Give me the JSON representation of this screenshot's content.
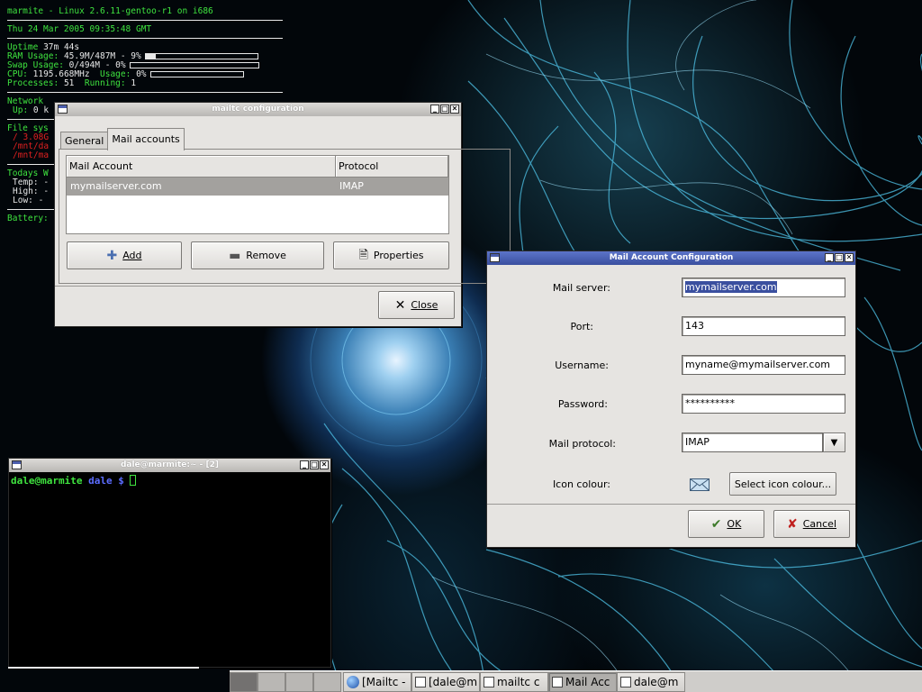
{
  "conky": {
    "header": "marmite - Linux 2.6.11-gentoo-r1 on i686",
    "datetime": "Thu 24 Mar 2005 09:35:48 GMT",
    "uptime_label": "Uptime",
    "uptime_value": "37m 44s",
    "ram_label": "RAM Usage:",
    "ram_value": "45.9M/487M - 9%",
    "ram_percent": 9,
    "swap_label": "Swap Usage:",
    "swap_value": "0/494M - 0%",
    "swap_percent": 0,
    "cpu_label": "CPU:",
    "cpu_value": "1195.668MHz",
    "cpu_usage_label": "Usage:",
    "cpu_usage_value": "0%",
    "cpu_percent": 0,
    "processes_label": "Processes:",
    "processes_value": "51",
    "running_label": "Running:",
    "running_value": "1",
    "network_label": "Network",
    "up_label": "Up:",
    "up_value": "0 k",
    "filesys_label": "File sys",
    "fs_root": "/ 3.08G",
    "fs_mnt1": "/mnt/da",
    "fs_mnt2": "/mnt/ma",
    "weather_label": "Todays W",
    "temp_label": "Temp:",
    "temp_value": "-",
    "high_label": "High:",
    "high_value": "-",
    "low_label": "Low:",
    "low_value": "-",
    "battery_label": "Battery:"
  },
  "mailtc_window": {
    "title": "mailtc configuration",
    "tabs": [
      "General",
      "Mail accounts"
    ],
    "selected_tab": "Mail accounts",
    "columns": [
      "Mail Account",
      "Protocol"
    ],
    "rows": [
      {
        "account": "mymailserver.com",
        "protocol": "IMAP"
      }
    ],
    "add_label": "Add",
    "remove_label": "Remove",
    "properties_label": "Properties",
    "close_label": "Close"
  },
  "terminal_window": {
    "title": "dale@marmite:~ - [2]",
    "prompt_user": "dale@marmite",
    "prompt_dir": "dale $"
  },
  "account_window": {
    "title": "Mail Account Configuration",
    "mail_server_label": "Mail server:",
    "mail_server_value": "mymailserver.com",
    "port_label": "Port:",
    "port_value": "143",
    "username_label": "Username:",
    "username_value": "myname@mymailserver.com",
    "password_label": "Password:",
    "password_value": "**********",
    "protocol_label": "Mail protocol:",
    "protocol_value": "IMAP",
    "icon_colour_label": "Icon colour:",
    "select_icon_colour_label": "Select icon colour...",
    "ok_label": "OK",
    "cancel_label": "Cancel"
  },
  "taskbar": {
    "tasks": [
      "[Mailtc -",
      "[dale@m",
      "mailtc c",
      "Mail Acc",
      "dale@m"
    ]
  },
  "colors": {
    "conky_green": "#3fe43f",
    "active_title": "#3a4f9f",
    "selection": "#3a4f9f"
  }
}
